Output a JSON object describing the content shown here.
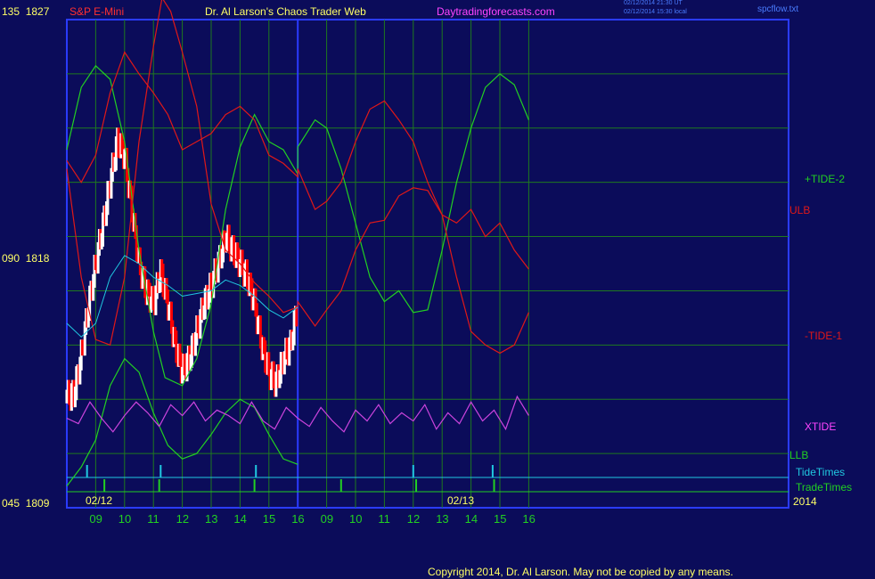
{
  "header": {
    "instrument": "S&P E-Mini",
    "title": "Dr. Al Larson's Chaos Trader Web",
    "website": "Daytradingforecasts.com",
    "timestamp_ut": "02/12/2014 21:30 UT",
    "timestamp_local": "02/12/2014 15:30 local",
    "filename": "spcflow.txt"
  },
  "footer": {
    "copyright": "Copyright 2014, Dr. Al Larson. May not be copied by any means."
  },
  "colors": {
    "background": "#0b0c5a",
    "frame": "#2a3bff",
    "grid": "#1f7a1f",
    "tide": "#22d022",
    "ulb": "#e01818",
    "xtide": "#cc44dd",
    "avg": "#20c8e0"
  },
  "chart_data": {
    "type": "line",
    "title": "S&P E-Mini",
    "y_axis_labels": [
      {
        "left": "135",
        "price": "1827",
        "value": 1827
      },
      {
        "left": "090",
        "price": "1818",
        "value": 1818
      },
      {
        "left": "045",
        "price": "1809",
        "value": 1809
      }
    ],
    "ylim": [
      1809,
      1827
    ],
    "x_hours": [
      8,
      33
    ],
    "x_tick_labels": [
      {
        "label": "09",
        "hour": 9
      },
      {
        "label": "10",
        "hour": 10
      },
      {
        "label": "11",
        "hour": 11
      },
      {
        "label": "12",
        "hour": 12
      },
      {
        "label": "13",
        "hour": 13
      },
      {
        "label": "14",
        "hour": 14
      },
      {
        "label": "15",
        "hour": 15
      },
      {
        "label": "16",
        "hour": 16
      },
      {
        "label": "09",
        "hour": 17
      },
      {
        "label": "10",
        "hour": 18
      },
      {
        "label": "11",
        "hour": 19
      },
      {
        "label": "12",
        "hour": 20
      },
      {
        "label": "13",
        "hour": 21
      },
      {
        "label": "14",
        "hour": 22
      },
      {
        "label": "15",
        "hour": 23
      },
      {
        "label": "16",
        "hour": 24
      }
    ],
    "date_labels": [
      {
        "label": "02/12",
        "hour": 8.5
      },
      {
        "label": "02/13",
        "hour": 16.8
      }
    ],
    "year_label": "2014",
    "series_labels": {
      "tide_plus": "+TIDE-2",
      "ulb": "ULB",
      "tide_minus": "-TIDE-1",
      "xtide": "XTIDE",
      "llb": "LLB",
      "tide_times": "TideTimes",
      "trade_times": "TradeTimes"
    },
    "series": [
      {
        "key": "tide_plus",
        "color": "#22d022",
        "points": [
          [
            8,
            1822.2
          ],
          [
            8.5,
            1824.5
          ],
          [
            9.0,
            1825.3
          ],
          [
            9.5,
            1824.8
          ],
          [
            10.0,
            1822.5
          ],
          [
            10.5,
            1818.5
          ],
          [
            11.0,
            1815.5
          ],
          [
            11.4,
            1813.8
          ],
          [
            12.0,
            1813.5
          ],
          [
            12.5,
            1814.5
          ],
          [
            13.0,
            1816.5
          ],
          [
            13.5,
            1820.0
          ],
          [
            14.0,
            1822.3
          ],
          [
            14.5,
            1823.5
          ],
          [
            15.0,
            1822.5
          ],
          [
            15.5,
            1822.2
          ],
          [
            16.0,
            1821.3
          ],
          [
            16.0,
            1822.3
          ],
          [
            16.6,
            1823.3
          ],
          [
            17.0,
            1823.0
          ],
          [
            17.5,
            1821.5
          ],
          [
            18.0,
            1819.5
          ],
          [
            18.5,
            1817.5
          ],
          [
            19.0,
            1816.6
          ],
          [
            19.5,
            1817.0
          ],
          [
            20.0,
            1816.2
          ],
          [
            20.5,
            1816.3
          ],
          [
            21.0,
            1818.5
          ],
          [
            21.5,
            1821.0
          ],
          [
            22.0,
            1823.0
          ],
          [
            22.5,
            1824.5
          ],
          [
            23.0,
            1825.0
          ],
          [
            23.5,
            1824.6
          ],
          [
            24.0,
            1823.3
          ]
        ]
      },
      {
        "key": "ulb",
        "color": "#e01818",
        "points": [
          [
            8,
            1821.8
          ],
          [
            8.5,
            1821.0
          ],
          [
            9.0,
            1822.0
          ],
          [
            9.5,
            1824.3
          ],
          [
            10.0,
            1825.8
          ],
          [
            10.5,
            1825.0
          ],
          [
            11.0,
            1824.3
          ],
          [
            11.5,
            1823.5
          ],
          [
            12.0,
            1822.2
          ],
          [
            12.5,
            1822.5
          ],
          [
            13.0,
            1822.8
          ],
          [
            13.5,
            1823.5
          ],
          [
            14.0,
            1823.8
          ],
          [
            14.5,
            1823.3
          ],
          [
            15.0,
            1822.0
          ],
          [
            15.5,
            1821.7
          ],
          [
            16.0,
            1821.2
          ],
          [
            16.0,
            1821.5
          ],
          [
            16.6,
            1820.0
          ],
          [
            17.0,
            1820.3
          ],
          [
            17.5,
            1821.0
          ],
          [
            18.0,
            1822.5
          ],
          [
            18.5,
            1823.7
          ],
          [
            19.0,
            1824.0
          ],
          [
            19.5,
            1823.3
          ],
          [
            20.0,
            1822.5
          ],
          [
            20.5,
            1821.0
          ],
          [
            21.0,
            1819.8
          ],
          [
            21.5,
            1819.5
          ],
          [
            22.0,
            1820.0
          ],
          [
            22.5,
            1819.0
          ],
          [
            23.0,
            1819.5
          ],
          [
            23.5,
            1818.5
          ],
          [
            24.0,
            1817.8
          ]
        ]
      },
      {
        "key": "tide_minus",
        "color": "#e01818",
        "points": [
          [
            8,
            1821.5
          ],
          [
            8.5,
            1817.5
          ],
          [
            9.0,
            1815.2
          ],
          [
            9.5,
            1815.0
          ],
          [
            10.0,
            1817.5
          ],
          [
            10.5,
            1822.5
          ],
          [
            11.0,
            1826.0
          ],
          [
            11.3,
            1827.8
          ],
          [
            11.6,
            1827.3
          ],
          [
            12.0,
            1825.8
          ],
          [
            12.5,
            1823.8
          ],
          [
            13.0,
            1820.2
          ],
          [
            13.5,
            1818.5
          ],
          [
            14.0,
            1818.0
          ],
          [
            14.5,
            1817.3
          ],
          [
            15.0,
            1816.8
          ],
          [
            15.5,
            1816.2
          ],
          [
            16.0,
            1816.4
          ],
          [
            16.0,
            1816.6
          ],
          [
            16.6,
            1815.7
          ],
          [
            17.0,
            1816.3
          ],
          [
            17.5,
            1817.0
          ],
          [
            18.0,
            1818.5
          ],
          [
            18.5,
            1819.5
          ],
          [
            19.0,
            1819.6
          ],
          [
            19.5,
            1820.5
          ],
          [
            20.0,
            1820.8
          ],
          [
            20.5,
            1820.7
          ],
          [
            21.0,
            1819.8
          ],
          [
            21.5,
            1817.5
          ],
          [
            22.0,
            1815.5
          ],
          [
            22.5,
            1815.0
          ],
          [
            23.0,
            1814.7
          ],
          [
            23.5,
            1815.0
          ],
          [
            24.0,
            1816.2
          ]
        ]
      },
      {
        "key": "llb",
        "color": "#22d022",
        "points": [
          [
            8,
            1809.8
          ],
          [
            8.5,
            1810.5
          ],
          [
            9.0,
            1811.5
          ],
          [
            9.5,
            1813.5
          ],
          [
            10.0,
            1814.5
          ],
          [
            10.5,
            1814.0
          ],
          [
            11.0,
            1812.5
          ],
          [
            11.5,
            1811.3
          ],
          [
            12.0,
            1810.8
          ],
          [
            12.5,
            1811.0
          ],
          [
            13.0,
            1811.7
          ],
          [
            13.5,
            1812.5
          ],
          [
            14.0,
            1813.0
          ],
          [
            14.5,
            1812.7
          ],
          [
            15.0,
            1811.7
          ],
          [
            15.5,
            1810.8
          ],
          [
            16.0,
            1810.6
          ]
        ]
      },
      {
        "key": "avg",
        "color": "#20c8e0",
        "points": [
          [
            8,
            1815.8
          ],
          [
            8.5,
            1815.3
          ],
          [
            9.0,
            1815.8
          ],
          [
            9.5,
            1817.5
          ],
          [
            10.0,
            1818.3
          ],
          [
            10.5,
            1818.0
          ],
          [
            11.0,
            1817.5
          ],
          [
            11.5,
            1817.2
          ],
          [
            12.0,
            1816.8
          ],
          [
            12.5,
            1816.9
          ],
          [
            13.0,
            1817.0
          ],
          [
            13.5,
            1817.4
          ],
          [
            14.0,
            1817.2
          ],
          [
            14.5,
            1816.8
          ],
          [
            15.0,
            1816.3
          ],
          [
            15.5,
            1816.0
          ],
          [
            16.0,
            1816.4
          ]
        ]
      },
      {
        "key": "xtide",
        "color": "#cc44dd",
        "points": [
          [
            8,
            1812.3
          ],
          [
            8.4,
            1812.1
          ],
          [
            8.8,
            1812.9
          ],
          [
            9.2,
            1812.3
          ],
          [
            9.6,
            1811.8
          ],
          [
            10.0,
            1812.4
          ],
          [
            10.4,
            1812.9
          ],
          [
            10.8,
            1812.5
          ],
          [
            11.2,
            1812.0
          ],
          [
            11.6,
            1812.8
          ],
          [
            12.0,
            1812.4
          ],
          [
            12.4,
            1812.9
          ],
          [
            12.8,
            1812.2
          ],
          [
            13.2,
            1812.6
          ],
          [
            13.6,
            1812.4
          ],
          [
            14.0,
            1812.1
          ],
          [
            14.4,
            1812.9
          ],
          [
            14.8,
            1812.2
          ],
          [
            15.2,
            1811.9
          ],
          [
            15.6,
            1812.7
          ],
          [
            16.0,
            1812.3
          ],
          [
            16.4,
            1812.0
          ],
          [
            16.8,
            1812.7
          ],
          [
            17.2,
            1812.2
          ],
          [
            17.6,
            1811.8
          ],
          [
            18.0,
            1812.6
          ],
          [
            18.4,
            1812.2
          ],
          [
            18.8,
            1812.8
          ],
          [
            19.2,
            1812.1
          ],
          [
            19.6,
            1812.5
          ],
          [
            20.0,
            1812.2
          ],
          [
            20.4,
            1812.8
          ],
          [
            20.8,
            1811.9
          ],
          [
            21.2,
            1812.5
          ],
          [
            21.6,
            1812.1
          ],
          [
            22.0,
            1812.9
          ],
          [
            22.4,
            1812.2
          ],
          [
            22.8,
            1812.6
          ],
          [
            23.2,
            1811.9
          ],
          [
            23.6,
            1813.1
          ],
          [
            24.0,
            1812.4
          ]
        ]
      }
    ],
    "price_bars": {
      "up_color": "#ffffff",
      "down_color": "#ff0000",
      "closes": [
        [
          8.0,
          1813.1
        ],
        [
          8.25,
          1813.2
        ],
        [
          8.5,
          1814.6
        ],
        [
          8.75,
          1816.4
        ],
        [
          9.0,
          1818.0
        ],
        [
          9.25,
          1819.4
        ],
        [
          9.5,
          1821.0
        ],
        [
          9.75,
          1822.5
        ],
        [
          10.0,
          1822.0
        ],
        [
          10.25,
          1820.0
        ],
        [
          10.5,
          1818.0
        ],
        [
          10.75,
          1817.0
        ],
        [
          11.0,
          1816.5
        ],
        [
          11.25,
          1817.7
        ],
        [
          11.5,
          1816.5
        ],
        [
          11.75,
          1815.0
        ],
        [
          12.0,
          1814.0
        ],
        [
          12.25,
          1814.5
        ],
        [
          12.5,
          1815.5
        ],
        [
          12.75,
          1816.5
        ],
        [
          13.0,
          1817.2
        ],
        [
          13.25,
          1818.0
        ],
        [
          13.5,
          1819.0
        ],
        [
          13.75,
          1818.5
        ],
        [
          14.0,
          1818.0
        ],
        [
          14.25,
          1817.5
        ],
        [
          14.5,
          1816.5
        ],
        [
          14.75,
          1815.0
        ],
        [
          15.0,
          1814.0
        ],
        [
          15.25,
          1813.6
        ],
        [
          15.5,
          1814.5
        ],
        [
          15.75,
          1815.0
        ],
        [
          16.0,
          1816.5
        ]
      ]
    },
    "tide_times_hours": [
      8.7,
      11.25,
      14.55,
      20.0,
      22.75
    ],
    "trade_times_hours": [
      9.3,
      11.2,
      14.5,
      17.5,
      20.1,
      22.8
    ]
  }
}
